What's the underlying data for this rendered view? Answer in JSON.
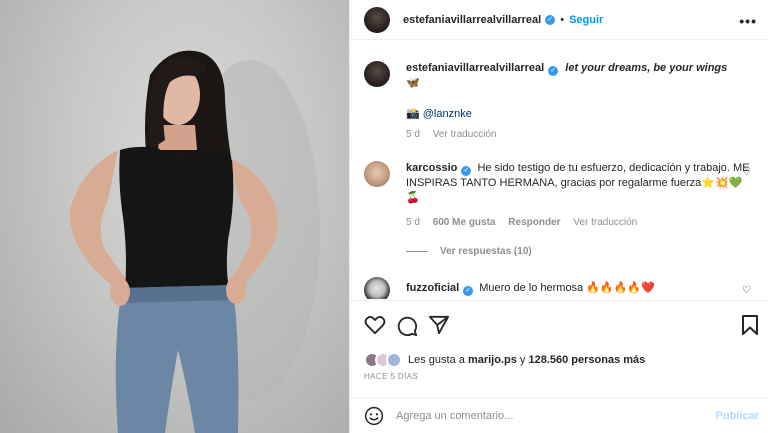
{
  "post": {
    "username": "estefaniavillarrealvillarreal",
    "separator": "•",
    "follow_label": "Seguir",
    "more_icon": "more-dots-icon"
  },
  "caption": {
    "username": "estefaniavillarrealvillarreal",
    "text": "let your dreams, be your wings",
    "emoji": "🦋",
    "credit_emoji": "📸",
    "credit": "@lanznke",
    "time": "5 d",
    "translate": "Ver traducción"
  },
  "comments": [
    {
      "username": "karcossio",
      "text": "He sido testigo de tu esfuerzo, dedicación y trabajo. ME INSPIRAS TANTO HERMANA, gracias por regalarme fuerza⭐💥💚 🍒",
      "time": "5 d",
      "likes": "600 Me gusta",
      "reply": "Responder",
      "translate": "Ver traducción",
      "replies": "Ver respuestas (10)"
    },
    {
      "username": "fuzzoficial",
      "text": "Muero de lo hermosa 🔥🔥🔥🔥❤️"
    }
  ],
  "likes": {
    "prefix": "Les gusta a",
    "user": "marijo.ps",
    "connector": "y",
    "others": "128.560 personas más"
  },
  "timestamp": "HACE 5 DÍAS",
  "add_comment": {
    "placeholder": "Agrega un comentario...",
    "publish": "Publicar"
  },
  "colors": {
    "accent": "#0095f6",
    "verified": "#3897f0",
    "muted": "#8e8e8e"
  }
}
